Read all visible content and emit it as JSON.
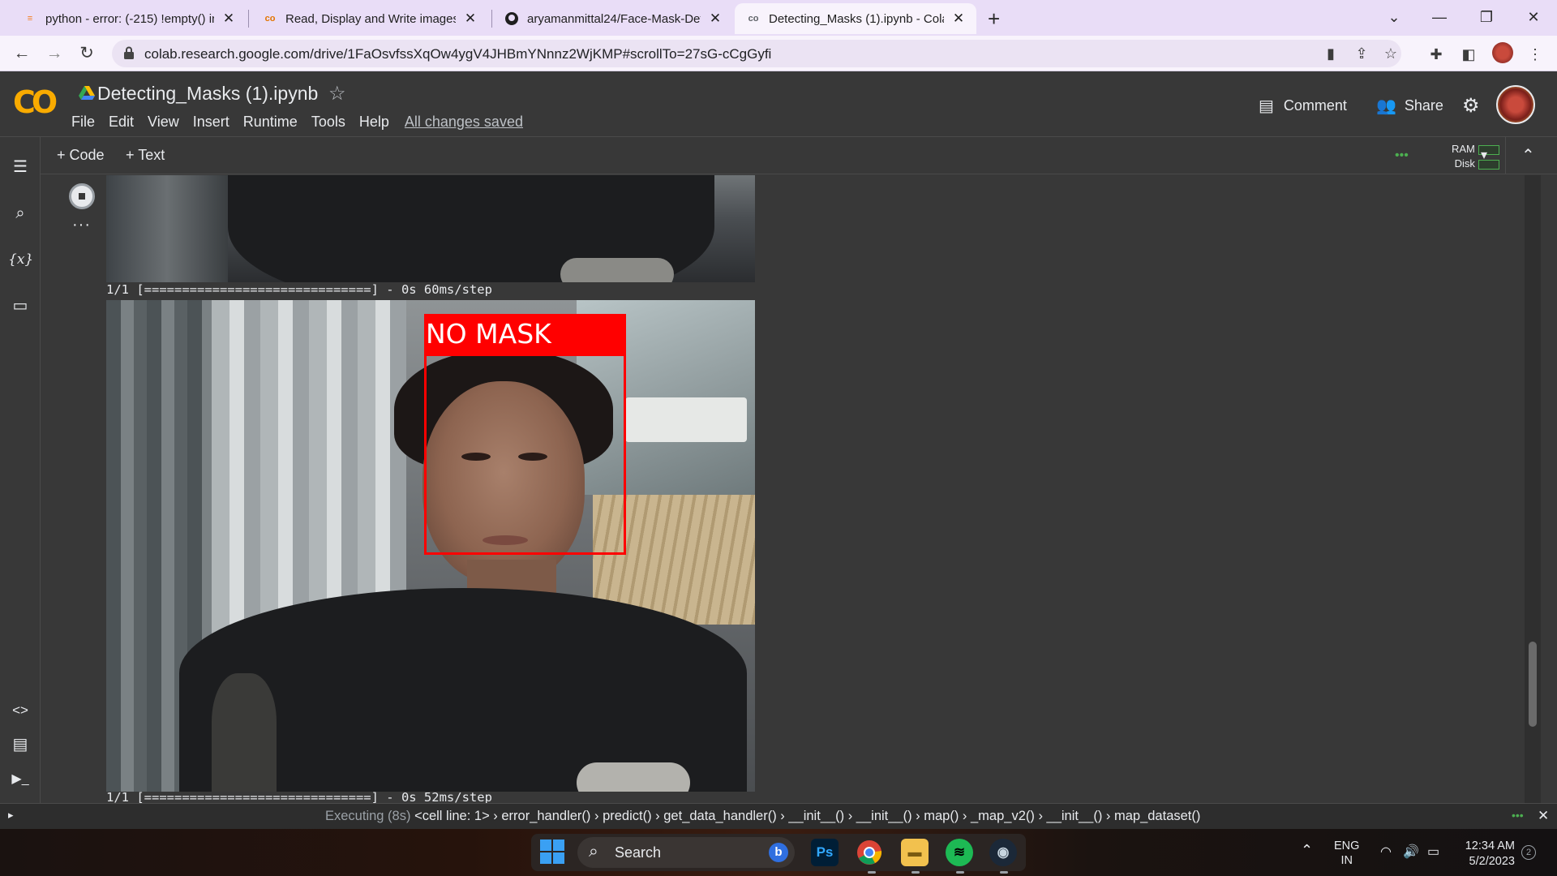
{
  "browser": {
    "tabs": [
      {
        "title": "python - error: (-215) !empty() in",
        "icon": "stackoverflow-icon",
        "active": false
      },
      {
        "title": "Read, Display and Write images.i",
        "icon": "colab-icon",
        "active": false
      },
      {
        "title": "aryamanmittal24/Face-Mask-Det",
        "icon": "github-icon",
        "active": false
      },
      {
        "title": "Detecting_Masks (1).ipynb - Cola",
        "icon": "colab-icon",
        "active": true
      }
    ],
    "new_tab": "+",
    "url": "colab.research.google.com/drive/1FaOsvfssXqOw4ygV4JHBmYNnnz2WjKMP#scrollTo=27sG-cCgGyfi"
  },
  "colab": {
    "logo": "CO",
    "notebook_title": "Detecting_Masks (1).ipynb",
    "menu": [
      "File",
      "Edit",
      "View",
      "Insert",
      "Runtime",
      "Tools",
      "Help"
    ],
    "save_status": "All changes saved",
    "comment_label": "Comment",
    "share_label": "Share",
    "add_code": "+ Code",
    "add_text": "+ Text",
    "ram_label": "RAM",
    "disk_label": "Disk"
  },
  "output": {
    "log_lines": [
      "1/1 [==============================] - 0s 60ms/step",
      "1/1 [==============================] - 0s 52ms/step"
    ],
    "detection_label": "NO MASK"
  },
  "status": {
    "prefix": "Executing (8s)",
    "trace": "<cell line: 1> › error_handler() › predict() › get_data_handler() › __init__() › __init__() › map() › _map_v2() › __init__() › map_dataset()"
  },
  "taskbar": {
    "search_label": "Search",
    "lang_top": "ENG",
    "lang_bottom": "IN",
    "time": "12:34 AM",
    "date": "5/2/2023",
    "notification_count": "2"
  },
  "colors": {
    "colab_orange": "#f9ab00",
    "detection_red": "#ff0000",
    "chrome_tab_bg": "#e9ddf7"
  }
}
